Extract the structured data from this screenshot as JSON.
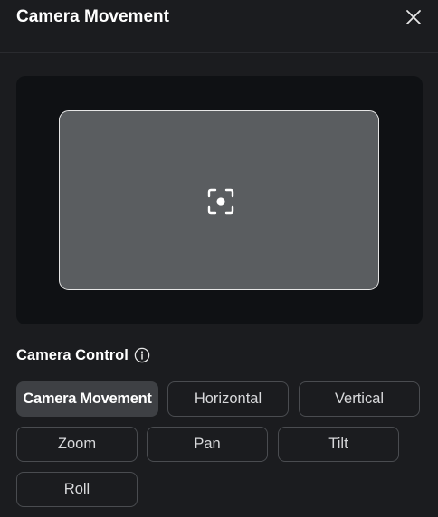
{
  "dialog": {
    "title": "Camera Movement",
    "close_icon": "close-icon"
  },
  "preview": {
    "focus_icon": "focus-target-icon"
  },
  "camera_control": {
    "label": "Camera Control",
    "info_icon": "info-icon",
    "selected": "Camera Movement",
    "options": [
      {
        "label": "Camera Movement"
      },
      {
        "label": "Horizontal"
      },
      {
        "label": "Vertical"
      },
      {
        "label": "Zoom"
      },
      {
        "label": "Pan"
      },
      {
        "label": "Tilt"
      },
      {
        "label": "Roll"
      }
    ]
  },
  "colors": {
    "background": "#1b1c1f",
    "preview_background": "#0f1114",
    "frame_fill": "#5a5d60",
    "active_option": "#3e4044",
    "option_border": "#4a4c50"
  }
}
